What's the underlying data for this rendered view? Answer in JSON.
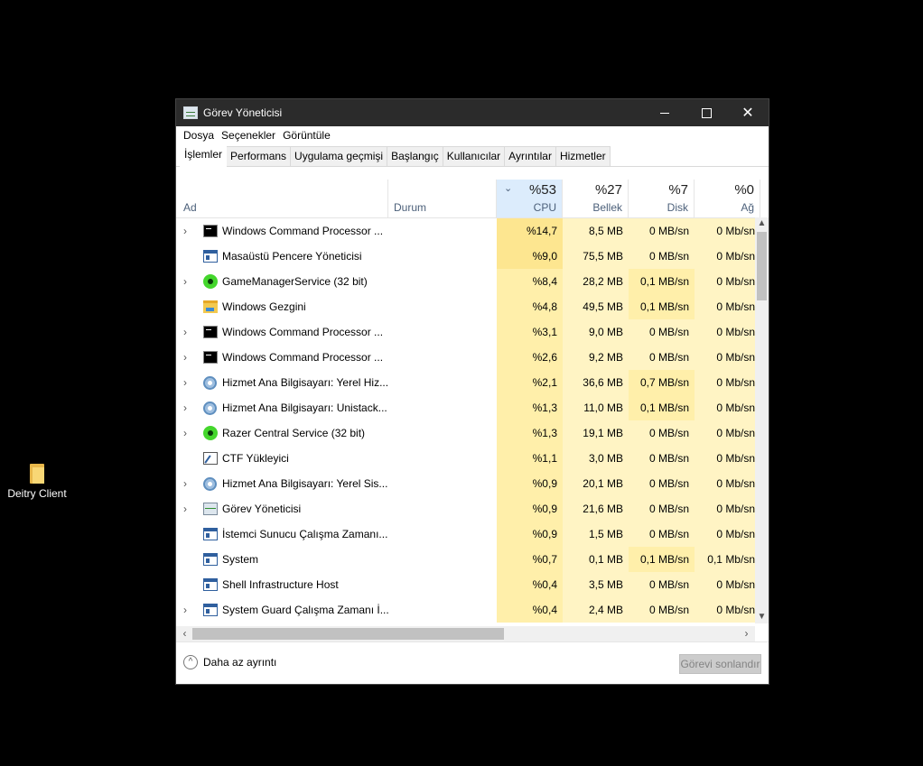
{
  "desktop": {
    "icon_label": "Deitry Client"
  },
  "window": {
    "title": "Görev Yöneticisi",
    "buttons": {
      "minimize": "—",
      "maximize": "☐",
      "close": "✕"
    }
  },
  "menu": [
    "Dosya",
    "Seçenekler",
    "Görüntüle"
  ],
  "tabs": [
    "İşlemler",
    "Performans",
    "Uygulama geçmişi",
    "Başlangıç",
    "Kullanıcılar",
    "Ayrıntılar",
    "Hizmetler"
  ],
  "active_tab": "İşlemler",
  "columns": {
    "name": "Ad",
    "status": "Durum",
    "cpu": {
      "pct": "%53",
      "label": "CPU"
    },
    "memory": {
      "pct": "%27",
      "label": "Bellek"
    },
    "disk": {
      "pct": "%7",
      "label": "Disk"
    },
    "network": {
      "pct": "%0",
      "label": "Ağ"
    }
  },
  "processes": [
    {
      "name": "Windows Command Processor ...",
      "icon": "cmd",
      "expandable": true,
      "cpu": "%14,7",
      "mem": "8,5 MB",
      "disk": "0 MB/sn",
      "net": "0 Mb/sn"
    },
    {
      "name": "Masaüstü Pencere Yöneticisi",
      "icon": "app",
      "expandable": false,
      "cpu": "%9,0",
      "mem": "75,5 MB",
      "disk": "0 MB/sn",
      "net": "0 Mb/sn"
    },
    {
      "name": "GameManagerService (32 bit)",
      "icon": "razer",
      "expandable": true,
      "cpu": "%8,4",
      "mem": "28,2 MB",
      "disk": "0,1 MB/sn",
      "net": "0 Mb/sn"
    },
    {
      "name": "Windows Gezgini",
      "icon": "folder",
      "expandable": false,
      "cpu": "%4,8",
      "mem": "49,5 MB",
      "disk": "0,1 MB/sn",
      "net": "0 Mb/sn"
    },
    {
      "name": "Windows Command Processor ...",
      "icon": "cmd",
      "expandable": true,
      "cpu": "%3,1",
      "mem": "9,0 MB",
      "disk": "0 MB/sn",
      "net": "0 Mb/sn"
    },
    {
      "name": "Windows Command Processor ...",
      "icon": "cmd",
      "expandable": true,
      "cpu": "%2,6",
      "mem": "9,2 MB",
      "disk": "0 MB/sn",
      "net": "0 Mb/sn"
    },
    {
      "name": "Hizmet Ana Bilgisayarı: Yerel Hiz...",
      "icon": "gear",
      "expandable": true,
      "cpu": "%2,1",
      "mem": "36,6 MB",
      "disk": "0,7 MB/sn",
      "net": "0 Mb/sn"
    },
    {
      "name": "Hizmet Ana Bilgisayarı: Unistack...",
      "icon": "gear",
      "expandable": true,
      "cpu": "%1,3",
      "mem": "11,0 MB",
      "disk": "0,1 MB/sn",
      "net": "0 Mb/sn"
    },
    {
      "name": "Razer Central Service (32 bit)",
      "icon": "razer",
      "expandable": true,
      "cpu": "%1,3",
      "mem": "19,1 MB",
      "disk": "0 MB/sn",
      "net": "0 Mb/sn"
    },
    {
      "name": "CTF Yükleyici",
      "icon": "ctf",
      "expandable": false,
      "cpu": "%1,1",
      "mem": "3,0 MB",
      "disk": "0 MB/sn",
      "net": "0 Mb/sn"
    },
    {
      "name": "Hizmet Ana Bilgisayarı: Yerel Sis...",
      "icon": "gear",
      "expandable": true,
      "cpu": "%0,9",
      "mem": "20,1 MB",
      "disk": "0 MB/sn",
      "net": "0 Mb/sn"
    },
    {
      "name": "Görev Yöneticisi",
      "icon": "tm",
      "expandable": true,
      "cpu": "%0,9",
      "mem": "21,6 MB",
      "disk": "0 MB/sn",
      "net": "0 Mb/sn"
    },
    {
      "name": "İstemci Sunucu Çalışma Zamanı...",
      "icon": "app",
      "expandable": false,
      "cpu": "%0,9",
      "mem": "1,5 MB",
      "disk": "0 MB/sn",
      "net": "0 Mb/sn"
    },
    {
      "name": "System",
      "icon": "app",
      "expandable": false,
      "cpu": "%0,7",
      "mem": "0,1 MB",
      "disk": "0,1 MB/sn",
      "net": "0,1 Mb/sn"
    },
    {
      "name": "Shell Infrastructure Host",
      "icon": "app",
      "expandable": false,
      "cpu": "%0,4",
      "mem": "3,5 MB",
      "disk": "0 MB/sn",
      "net": "0 Mb/sn"
    },
    {
      "name": "System Guard Çalışma Zamanı İ...",
      "icon": "app",
      "expandable": true,
      "cpu": "%0,4",
      "mem": "2,4 MB",
      "disk": "0 MB/sn",
      "net": "0 Mb/sn"
    }
  ],
  "colors": {
    "cpu_high": "#fde690",
    "cell_low": "#fff4c4",
    "cell_mid": "#ffefaa",
    "sorted_header": "#dcecfc"
  },
  "footer": {
    "fewer_details": "Daha az ayrıntı",
    "end_task": "Görevi sonlandır"
  }
}
